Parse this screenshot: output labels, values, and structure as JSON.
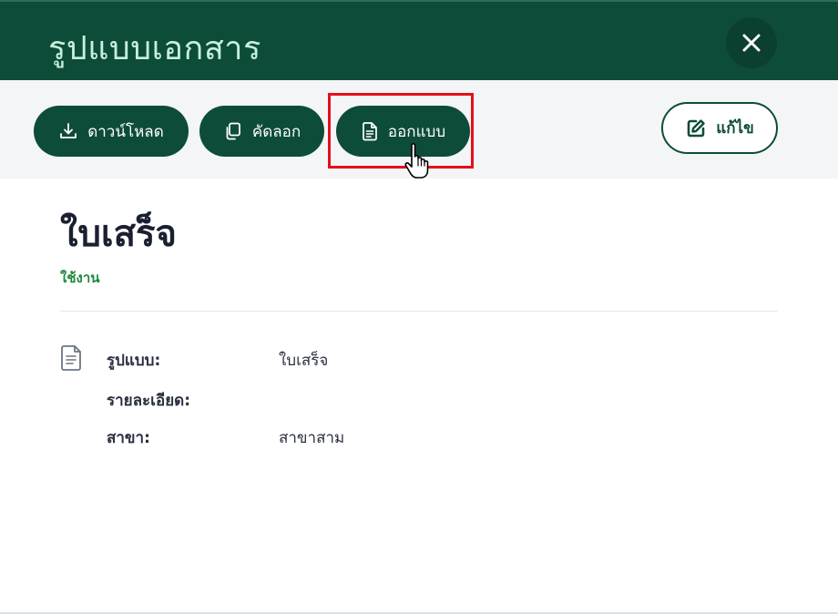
{
  "header": {
    "title": "รูปแบบเอกสาร",
    "close_icon": "close-icon"
  },
  "toolbar": {
    "download_label": "ดาวน์โหลด",
    "copy_label": "คัดลอก",
    "design_label": "ออกแบบ",
    "edit_label": "แก้ไข"
  },
  "document": {
    "title": "ใบเสร็จ",
    "status": "ใช้งาน",
    "fields": [
      {
        "label": "รูปแบบ:",
        "value": "ใบเสร็จ"
      },
      {
        "label": "รายละเอียด:",
        "value": ""
      },
      {
        "label": "สาขา:",
        "value": "สาขาสาม"
      }
    ]
  },
  "colors": {
    "brand": "#0e4c3a",
    "title_text": "#c6f0dc",
    "status_active": "#1d8a3c",
    "highlight": "#e3101a"
  }
}
